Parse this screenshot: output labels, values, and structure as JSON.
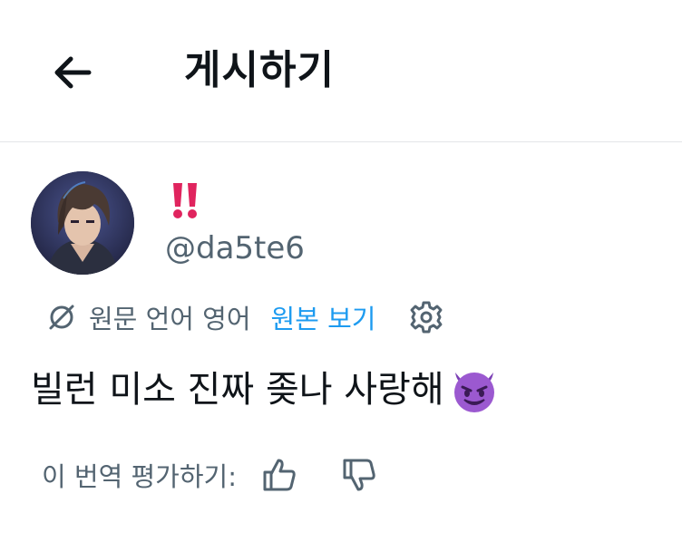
{
  "header": {
    "back_icon": "arrow-left-icon",
    "title": "게시하기"
  },
  "post": {
    "display_name": "‼️",
    "username": "@da5te6",
    "translation": {
      "icon": "globe-slash-icon",
      "info": "원문 언어 영어",
      "show_original": "원본 보기",
      "settings_icon": "gear-icon"
    },
    "text": "빌런 미소 진짜 좆나 사랑해",
    "emoji": "smiling-imp-emoji",
    "rate": {
      "label": "이 번역 평가하기:",
      "up_icon": "thumbs-up-icon",
      "down_icon": "thumbs-down-icon"
    }
  },
  "colors": {
    "text": "#0f1419",
    "secondary": "#536471",
    "link": "#1d9bf0",
    "divider": "#e3e5e8",
    "exclaim": "#e0245e",
    "emoji": "#9b59d0"
  }
}
